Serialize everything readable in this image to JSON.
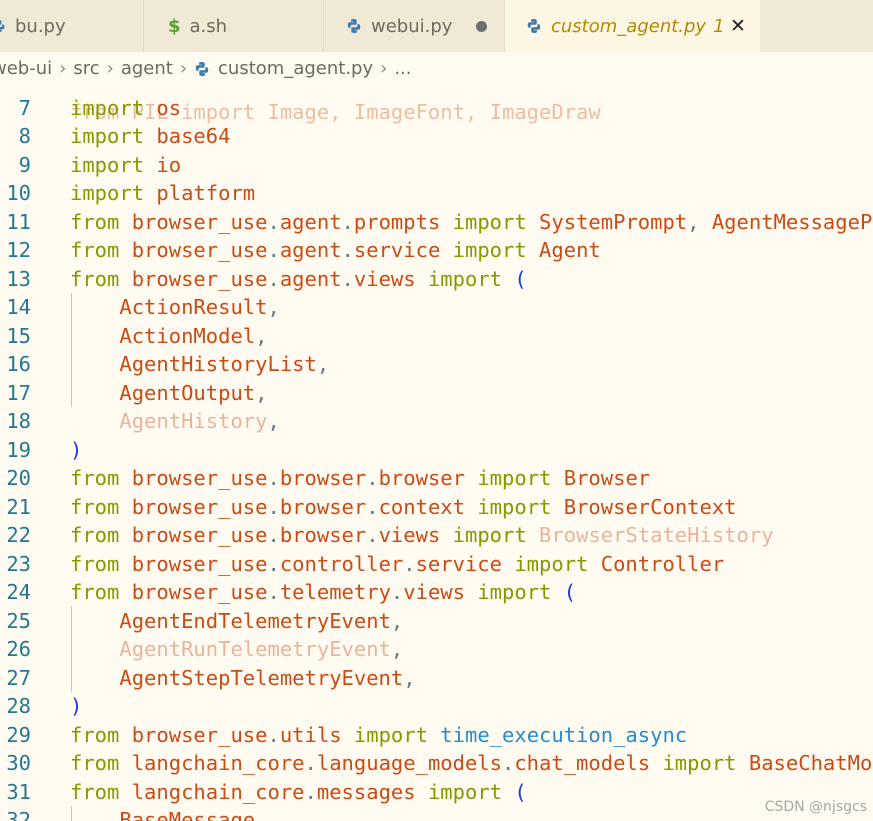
{
  "tabs": [
    {
      "label": "bu.py",
      "icon": "python-icon"
    },
    {
      "label": "a.sh",
      "icon": "shell-dollar-icon"
    },
    {
      "label": "webui.py",
      "icon": "python-icon",
      "unsaved": true
    },
    {
      "label": "custom_agent.py",
      "icon": "python-icon",
      "badge": "1",
      "active": true
    }
  ],
  "breadcrumb": {
    "items": [
      "web-ui",
      "src",
      "agent",
      "custom_agent.py",
      "..."
    ]
  },
  "editor": {
    "top_partial": "from PIL import Image, ImageFont, ImageDraw",
    "lines": [
      {
        "n": "7",
        "text": "import os"
      },
      {
        "n": "8",
        "text": "import base64"
      },
      {
        "n": "9",
        "text": "import io"
      },
      {
        "n": "10",
        "text": "import platform"
      },
      {
        "n": "11",
        "text": "from browser_use.agent.prompts import SystemPrompt, AgentMessagePrompt"
      },
      {
        "n": "12",
        "text": "from browser_use.agent.service import Agent"
      },
      {
        "n": "13",
        "text": "from browser_use.agent.views import ("
      },
      {
        "n": "14",
        "text": "    ActionResult,"
      },
      {
        "n": "15",
        "text": "    ActionModel,"
      },
      {
        "n": "16",
        "text": "    AgentHistoryList,"
      },
      {
        "n": "17",
        "text": "    AgentOutput,"
      },
      {
        "n": "18",
        "text": "    AgentHistory,"
      },
      {
        "n": "19",
        "text": ")"
      },
      {
        "n": "20",
        "text": "from browser_use.browser.browser import Browser"
      },
      {
        "n": "21",
        "text": "from browser_use.browser.context import BrowserContext"
      },
      {
        "n": "22",
        "text": "from browser_use.browser.views import BrowserStateHistory"
      },
      {
        "n": "23",
        "text": "from browser_use.controller.service import Controller"
      },
      {
        "n": "24",
        "text": "from browser_use.telemetry.views import ("
      },
      {
        "n": "25",
        "text": "    AgentEndTelemetryEvent,"
      },
      {
        "n": "26",
        "text": "    AgentRunTelemetryEvent,"
      },
      {
        "n": "27",
        "text": "    AgentStepTelemetryEvent,"
      },
      {
        "n": "28",
        "text": ")"
      },
      {
        "n": "29",
        "text": "from browser_use.utils import time_execution_async"
      },
      {
        "n": "30",
        "text": "from langchain_core.language_models.chat_models import BaseChatModel"
      },
      {
        "n": "31",
        "text": "from langchain_core.messages import ("
      },
      {
        "n": "32",
        "text": "    BaseMessage,"
      }
    ]
  },
  "watermark": "CSDN @njsgcs",
  "colors": {
    "keyword": "#859900",
    "module": "#cb4b16",
    "identifier": "#cb4b16",
    "unused_identifier": "#e7b59c",
    "function": "#268bd2",
    "bracket": "#1d3bd6",
    "line_number": "#237893",
    "background": "#fffbf0",
    "tab_active_text": "#b58900"
  }
}
